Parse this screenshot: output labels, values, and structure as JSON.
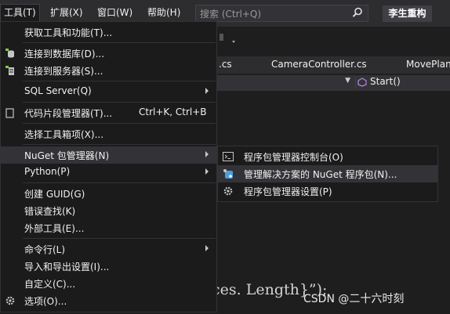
{
  "menubar": {
    "items": [
      "工具(T)",
      "扩展(X)",
      "窗口(W)",
      "帮助(H)"
    ],
    "search_placeholder": "搜索 (Ctrl+Q)",
    "user_button": "李生重构"
  },
  "editor": {
    "tabs": [
      ".cs",
      "CameraController.cs",
      "MovePlan"
    ],
    "nav_member": "Start()",
    "code_fragment": "ces. Length}”);"
  },
  "tools_menu": {
    "items": [
      {
        "label": "获取工具和功能(T)...",
        "shortcut": "",
        "icon": ""
      },
      {
        "label": "连接到数据库(D)...",
        "shortcut": "",
        "icon": "database-connect-icon"
      },
      {
        "label": "连接到服务器(S)...",
        "shortcut": "",
        "icon": "server-connect-icon"
      },
      {
        "label": "SQL Server(Q)",
        "shortcut": "",
        "icon": ""
      },
      {
        "label": "代码片段管理器(T)...",
        "shortcut": "Ctrl+K, Ctrl+B",
        "icon": "snippet-icon"
      },
      {
        "label": "选择工具箱项(X)...",
        "shortcut": "",
        "icon": ""
      },
      {
        "label": "NuGet 包管理器(N)",
        "shortcut": "",
        "icon": ""
      },
      {
        "label": "Python(P)",
        "shortcut": "",
        "icon": ""
      },
      {
        "label": "创建 GUID(G)",
        "shortcut": "",
        "icon": ""
      },
      {
        "label": "错误查找(K)",
        "shortcut": "",
        "icon": ""
      },
      {
        "label": "外部工具(E)...",
        "shortcut": "",
        "icon": ""
      },
      {
        "label": "命令行(L)",
        "shortcut": "",
        "icon": ""
      },
      {
        "label": "导入和导出设置(I)...",
        "shortcut": "",
        "icon": ""
      },
      {
        "label": "自定义(C)...",
        "shortcut": "",
        "icon": ""
      },
      {
        "label": "选项(O)...",
        "shortcut": "",
        "icon": "gear-icon"
      }
    ]
  },
  "nuget_submenu": {
    "items": [
      {
        "label": "程序包管理器控制台(O)",
        "icon": "console-icon"
      },
      {
        "label": "管理解决方案的 NuGet 程序包(N)...",
        "icon": "nuget-package-icon"
      },
      {
        "label": "程序包管理器设置(P)",
        "icon": "gear-icon"
      }
    ]
  },
  "watermark": "CSDN @二十六时刻",
  "colors": {
    "menu_bg": "#1b1b1c",
    "highlight": "#333337",
    "menubar_bg": "#2d2d30",
    "editor_bg": "#1e1e1e"
  }
}
